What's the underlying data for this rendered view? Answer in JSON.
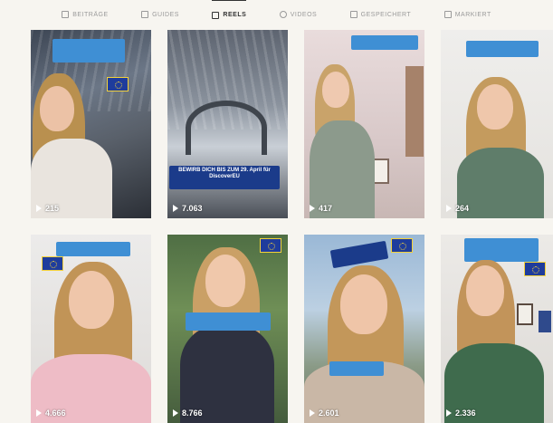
{
  "tabs": [
    {
      "label": "Beiträge",
      "active": false
    },
    {
      "label": "Guides",
      "active": false
    },
    {
      "label": "Reels",
      "active": true
    },
    {
      "label": "Videos",
      "active": false
    },
    {
      "label": "Gespeichert",
      "active": false
    },
    {
      "label": "Markiert",
      "active": false
    }
  ],
  "reels": [
    {
      "views": "215"
    },
    {
      "views": "7.063"
    },
    {
      "views": "417"
    },
    {
      "views": "264"
    },
    {
      "views": "4.666"
    },
    {
      "views": "8.766"
    },
    {
      "views": "2.601"
    },
    {
      "views": "2.336"
    }
  ],
  "captions": {
    "reel2_banner": "BEWIRB DICH BIS ZUM 29. April für DiscoverEU"
  },
  "colors": {
    "caption_blue": "#3f8fd4",
    "banner_navy": "#1b3b8a",
    "eu_blue": "#1e3c9c",
    "eu_gold": "#f4d23a"
  }
}
